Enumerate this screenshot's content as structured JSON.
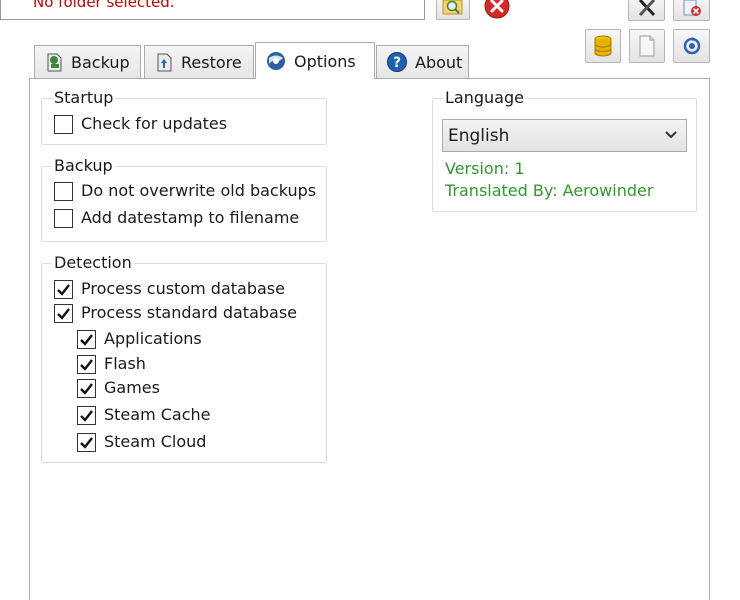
{
  "folder": {
    "status_text": "No folder selected."
  },
  "toolbar": {
    "browse_icon": "folder-search-icon",
    "clear_icon": "red-x-icon",
    "tools_icon": "tools-icon",
    "delete_icon": "delete-icon",
    "database_icon": "database-icon",
    "notes_icon": "notes-icon",
    "refresh_icon": "refresh-icon"
  },
  "tabs": [
    {
      "label": "Backup",
      "icon": "backup-icon",
      "active": false
    },
    {
      "label": "Restore",
      "icon": "restore-icon",
      "active": false
    },
    {
      "label": "Options",
      "icon": "options-icon",
      "active": true
    },
    {
      "label": "About",
      "icon": "help-icon",
      "active": false
    }
  ],
  "startup": {
    "title": "Startup",
    "check_updates": {
      "label": "Check for updates",
      "checked": false
    }
  },
  "backup": {
    "title": "Backup",
    "no_overwrite": {
      "label": "Do not overwrite old backups",
      "checked": false
    },
    "datestamp": {
      "label": "Add datestamp to filename",
      "checked": false
    }
  },
  "detection": {
    "title": "Detection",
    "custom_db": {
      "label": "Process custom database",
      "checked": true
    },
    "standard_db": {
      "label": "Process standard database",
      "checked": true
    },
    "children": [
      {
        "label": "Applications",
        "checked": true
      },
      {
        "label": "Flash",
        "checked": true
      },
      {
        "label": "Games",
        "checked": true
      },
      {
        "label": "Steam Cache",
        "checked": true
      },
      {
        "label": "Steam Cloud",
        "checked": true
      }
    ]
  },
  "language": {
    "title": "Language",
    "selected": "English",
    "version": "Version: 1",
    "translated_by": "Translated By: Aerowinder"
  },
  "colors": {
    "error_text": "#cc0000",
    "info_text": "#2e9a2e"
  }
}
